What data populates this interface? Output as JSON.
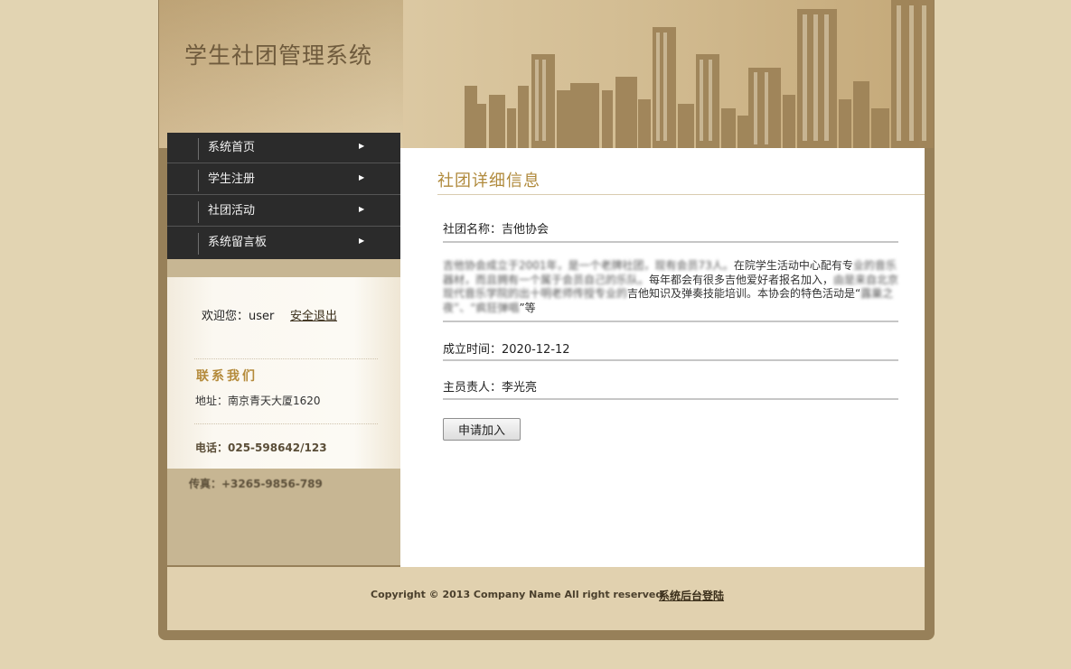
{
  "site": {
    "title": "学生社团管理系统"
  },
  "nav": {
    "items": [
      {
        "label": "系统首页"
      },
      {
        "label": "学生注册"
      },
      {
        "label": "社团活动"
      },
      {
        "label": "系统留言板"
      }
    ]
  },
  "user": {
    "welcome": "欢迎您：user",
    "logout_label": "安全退出"
  },
  "contact": {
    "title": "联系我们",
    "address": "地址：南京青天大厦1620",
    "phone": "电话：025-598642/123",
    "fax": "传真：+3265-9856-789"
  },
  "detail": {
    "heading": "社团详细信息",
    "name_line": "社团名称：吉他协会",
    "description_blurred_head": "吉他协会成立于2001年，是一个老牌社团，现有会员73人。",
    "description_part1": "在院学生活动中心配有专",
    "description_blurred_mid": "业的音乐器材，而且拥有一个属于会员自己的乐队。",
    "description_part2": "每年都会有很多吉他爱好者报名加入，",
    "description_blurred_tail": "由是来自北京现代音乐学院的出十明老师传授专业的",
    "description_part3": "吉他知识及弹奏技能培训。本协会的特色活动是“",
    "description_blurred_events": "露巢之夜”、“疯狂弹唱",
    "description_part4": "”等",
    "founded_line": "成立时间：2020-12-12",
    "leader_line": "主员责人：李光亮",
    "apply_label": "申请加入"
  },
  "footer": {
    "copyright": "Copyright © 2013 Company Name All right reserved",
    "admin_link": "系统后台登陆"
  },
  "colors": {
    "accent": "#b08a3c",
    "frame": "#978059",
    "background": "#e2d4b2",
    "nav_bg": "#2b2b2b"
  }
}
